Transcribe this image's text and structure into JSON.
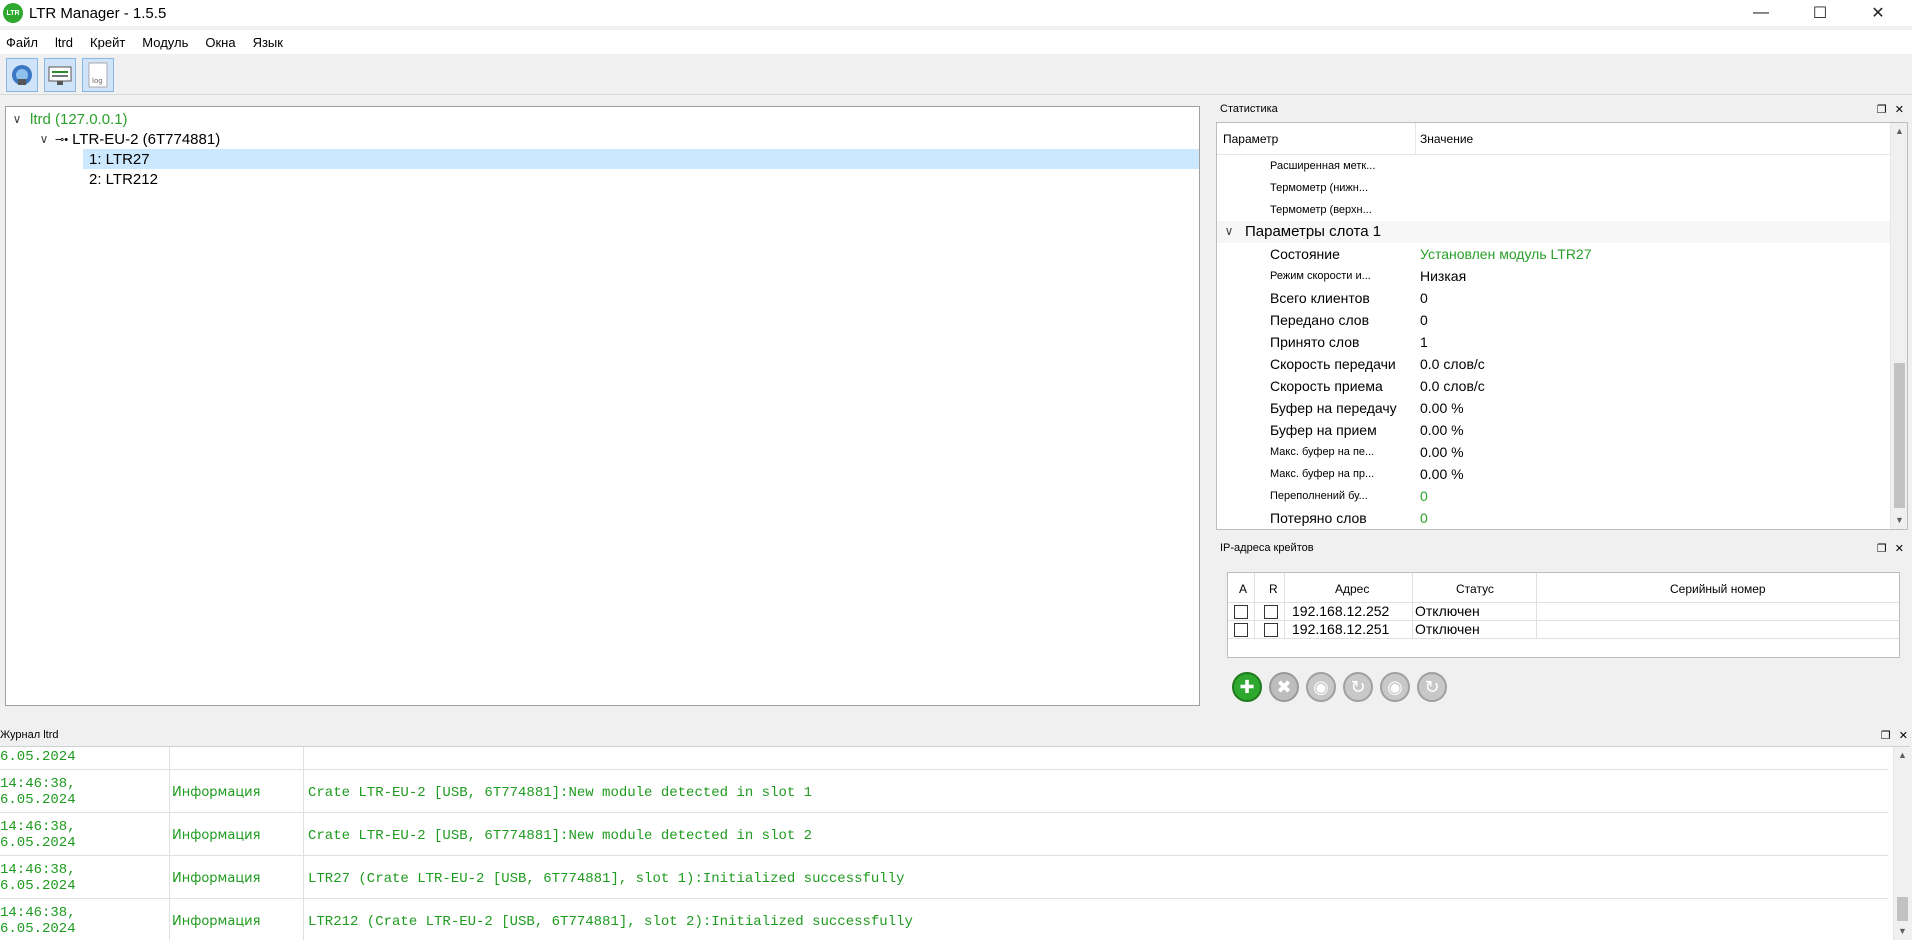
{
  "app": {
    "title": "LTR Manager - 1.5.5",
    "logo_text": "LTR"
  },
  "menu": [
    "Файл",
    "ltrd",
    "Крейт",
    "Модуль",
    "Окна",
    "Язык"
  ],
  "toolbar": {
    "buttons": [
      "connect-icon",
      "crate-view-icon",
      "log-icon"
    ],
    "log_label": "log"
  },
  "tree": {
    "root": "ltrd (127.0.0.1)",
    "crate": "LTR-EU-2 (6T774881)",
    "modules": [
      "1: LTR27",
      "2: LTR212"
    ]
  },
  "stats": {
    "title": "Статистика",
    "col_param": "Параметр",
    "col_value": "Значение",
    "top_rows": [
      "Расширенная метк...",
      "Термометр (нижн...",
      "Термометр (верхн..."
    ],
    "group": "Параметры слота 1",
    "rows": [
      {
        "p": "Состояние",
        "v": "Установлен модуль LTR27"
      },
      {
        "p": "Режим скорости и...",
        "v": "Низкая"
      },
      {
        "p": "Всего клиентов",
        "v": "0"
      },
      {
        "p": "Передано слов",
        "v": "0"
      },
      {
        "p": "Принято слов",
        "v": "1"
      },
      {
        "p": "Скорость передачи",
        "v": "0.0 слов/с"
      },
      {
        "p": "Скорость приема",
        "v": "0.0 слов/с"
      },
      {
        "p": "Буфер на передачу",
        "v": "0.00 %"
      },
      {
        "p": "Буфер на прием",
        "v": "0.00 %"
      },
      {
        "p": "Макс. буфер на пе...",
        "v": "0.00 %"
      },
      {
        "p": "Макс. буфер на пр...",
        "v": "0.00 %"
      },
      {
        "p": "Переполнений бу...",
        "v": "0"
      },
      {
        "p": "Потеряно слов",
        "v": "0"
      }
    ]
  },
  "ip": {
    "title": "IP-адреса крейтов",
    "headers": [
      "A",
      "R",
      "Адрес",
      "Статус",
      "Серийный номер"
    ],
    "rows": [
      {
        "addr": "192.168.12.252",
        "status": "Отключен",
        "serial": ""
      },
      {
        "addr": "192.168.12.251",
        "status": "Отключен",
        "serial": ""
      }
    ]
  },
  "log": {
    "title": "Журнал ltrd",
    "partial_time": "6.05.2024",
    "entries": [
      {
        "time": "14:46:38,\n6.05.2024",
        "level": "Информация",
        "msg": "Crate LTR-EU-2 [USB, 6T774881]:New module detected in slot 1"
      },
      {
        "time": "14:46:38,\n6.05.2024",
        "level": "Информация",
        "msg": "Crate LTR-EU-2 [USB, 6T774881]:New module detected in slot 2"
      },
      {
        "time": "14:46:38,\n6.05.2024",
        "level": "Информация",
        "msg": "LTR27 (Crate LTR-EU-2 [USB, 6T774881], slot 1):Initialized successfully"
      },
      {
        "time": "14:46:38,\n6.05.2024",
        "level": "Информация",
        "msg": "LTR212 (Crate LTR-EU-2 [USB, 6T774881], slot 2):Initialized successfully"
      }
    ]
  },
  "colors": {
    "green": "#2aa02a",
    "selection": "#cce8ff"
  }
}
